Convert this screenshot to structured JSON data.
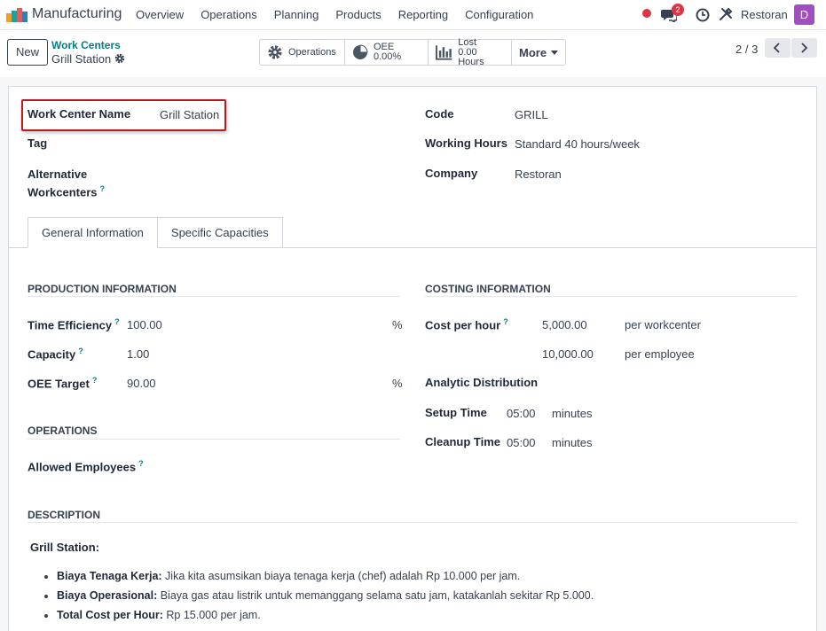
{
  "navbar": {
    "app_name": "Manufacturing",
    "menu": [
      "Overview",
      "Operations",
      "Planning",
      "Products",
      "Reporting",
      "Configuration"
    ],
    "chat_count": "2",
    "company": "Restoran",
    "avatar_letter": "D"
  },
  "control": {
    "new_label": "New",
    "breadcrumb_parent": "Work Centers",
    "breadcrumb_current": "Grill Station",
    "stats": {
      "operations_label": "Operations",
      "oee_label": "OEE",
      "oee_value": "0.00%",
      "lost_label": "Lost",
      "lost_value": "0.00 Hours",
      "more_label": "More"
    },
    "pager": "2 / 3"
  },
  "form": {
    "work_center_name_label": "Work Center Name",
    "work_center_name": "Grill Station",
    "tag_label": "Tag",
    "alt_label_1": "Alternative",
    "alt_label_2": "Workcenters",
    "code_label": "Code",
    "code": "GRILL",
    "working_hours_label": "Working Hours",
    "working_hours": "Standard 40 hours/week",
    "company_label": "Company",
    "company": "Restoran"
  },
  "tabs": [
    "General Information",
    "Specific Capacities"
  ],
  "production": {
    "heading": "PRODUCTION INFORMATION",
    "time_efficiency_label": "Time Efficiency",
    "time_efficiency": "100.00",
    "time_efficiency_unit": "%",
    "capacity_label": "Capacity",
    "capacity": "1.00",
    "oee_target_label": "OEE Target",
    "oee_target": "90.00",
    "oee_target_unit": "%"
  },
  "operations": {
    "heading": "OPERATIONS",
    "allowed_employees_label": "Allowed Employees"
  },
  "costing": {
    "heading": "COSTING INFORMATION",
    "cost_per_hour_label": "Cost per hour",
    "cost_workcenter": "5,000.00",
    "cost_workcenter_unit": "per workcenter",
    "cost_employee": "10,000.00",
    "cost_employee_unit": "per employee",
    "analytic_label": "Analytic Distribution",
    "setup_label": "Setup Time",
    "setup_value": "05:00",
    "setup_unit": "minutes",
    "cleanup_label": "Cleanup Time",
    "cleanup_value": "05:00",
    "cleanup_unit": "minutes"
  },
  "description": {
    "heading": "DESCRIPTION",
    "title": "Grill Station:",
    "items": [
      {
        "bold": "Biaya Tenaga Kerja:",
        "text": " Jika kita asumsikan biaya tenaga kerja (chef) adalah Rp 10.000 per jam."
      },
      {
        "bold": "Biaya Operasional:",
        "text": " Biaya gas atau listrik untuk memanggang selama satu jam, katakanlah sekitar Rp 5.000."
      },
      {
        "bold": "Total Cost per Hour:",
        "text": " Rp 15.000 per jam."
      }
    ]
  },
  "help_mark": "?"
}
